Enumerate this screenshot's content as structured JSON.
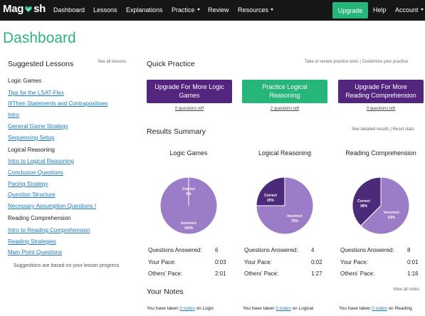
{
  "nav": {
    "logo_left": "Mag",
    "logo_right": "sh",
    "items": [
      {
        "label": "Dashboard"
      },
      {
        "label": "Lessons"
      },
      {
        "label": "Explanations"
      },
      {
        "label": "Practice"
      },
      {
        "label": "Review"
      },
      {
        "label": "Resources"
      }
    ],
    "upgrade_label": "Upgrade",
    "help_label": "Help",
    "account_label": "Account",
    "colors": {
      "bar": "#161616",
      "upgrade": "#27b67a"
    }
  },
  "page_title": "Dashboard",
  "sidebar": {
    "heading": "Suggested Lessons",
    "see_all": "See all lessons",
    "groups": [
      {
        "title": "Logic Games",
        "links": [
          "Tips for the LSAT-Flex",
          "If/Then Statements and Contrapositives",
          "Intro",
          "General Game Strategy",
          "Sequencing Setup"
        ]
      },
      {
        "title": "Logical Reasoning",
        "links": [
          "Intro to Logical Reasoning",
          "Conclusion Questions",
          "Pacing Strategy",
          "Question Structure",
          "Necessary Assumption Questions I"
        ]
      },
      {
        "title": "Reading Comprehension",
        "links": [
          "Intro to Reading Comprehension",
          "Reading Strategies",
          "Main Point Questions"
        ]
      }
    ],
    "note": "Suggestions are based on your lesson progress"
  },
  "quick_practice": {
    "title": "Quick Practice",
    "aux": "Take or review practice tests | Customize your practice",
    "buttons": [
      {
        "label": "Upgrade For More Logic Games",
        "sub": "0 questions left",
        "color": "#54257f"
      },
      {
        "label": "Practice Logical Reasoning",
        "sub": "2 questions left",
        "color": "#27b67a"
      },
      {
        "label": "Upgrade For More Reading Comprehension",
        "sub": "0 questions left",
        "color": "#54257f"
      }
    ]
  },
  "results": {
    "title": "Results Summary",
    "aux": "See detailed results | Reset stats",
    "row_labels": [
      "Questions Answered:",
      "Your Pace:",
      "Others' Pace:"
    ],
    "columns": [
      {
        "title": "Logic Games",
        "correct_label": "Correct",
        "correct_pct": "0%",
        "incorrect_label": "Incorrect",
        "incorrect_pct": "100%",
        "correct_frac": 0.0,
        "answered": "6",
        "your_pace": "0:03",
        "others_pace": "2:01"
      },
      {
        "title": "Logical Reasoning",
        "correct_label": "Correct",
        "correct_pct": "25%",
        "incorrect_label": "Incorrect",
        "incorrect_pct": "75%",
        "correct_frac": 0.25,
        "answered": "4",
        "your_pace": "0:02",
        "others_pace": "1:27"
      },
      {
        "title": "Reading Comprehension",
        "correct_label": "Correct",
        "correct_pct": "38%",
        "incorrect_label": "Incorrect",
        "incorrect_pct": "63%",
        "correct_frac": 0.375,
        "answered": "8",
        "your_pace": "0:01",
        "others_pace": "1:16"
      }
    ],
    "colors": {
      "correct": "#4c2a7a",
      "incorrect": "#9b7cc6",
      "divider": "#ffffff"
    }
  },
  "notes": {
    "title": "Your Notes",
    "aux": "View all notes",
    "items": [
      {
        "pre": "You have taken",
        "link": "0 notes",
        "post": "on Logic"
      },
      {
        "pre": "You have taken",
        "link": "0 notes",
        "post": "on Logical"
      },
      {
        "pre": "You have taken",
        "link": "0 notes",
        "post": "on Reading"
      }
    ]
  }
}
